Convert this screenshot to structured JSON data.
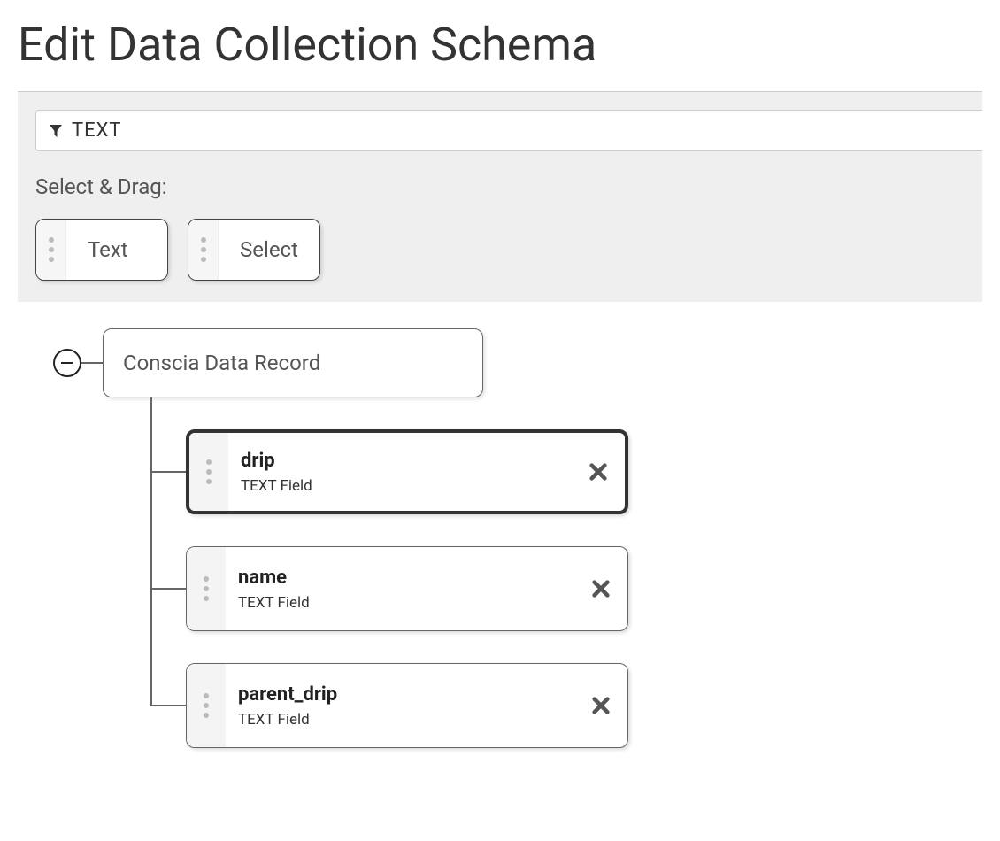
{
  "page": {
    "title": "Edit Data Collection Schema"
  },
  "toolbar": {
    "filter_value": "TEXT",
    "section_label": "Select & Drag:",
    "chips": [
      {
        "label": "Text"
      },
      {
        "label": "Select"
      }
    ]
  },
  "tree": {
    "root_label": "Conscia Data Record",
    "fields": [
      {
        "name": "drip",
        "type_label": "TEXT Field",
        "selected": true
      },
      {
        "name": "name",
        "type_label": "TEXT Field",
        "selected": false
      },
      {
        "name": "parent_drip",
        "type_label": "TEXT Field",
        "selected": false
      }
    ]
  }
}
